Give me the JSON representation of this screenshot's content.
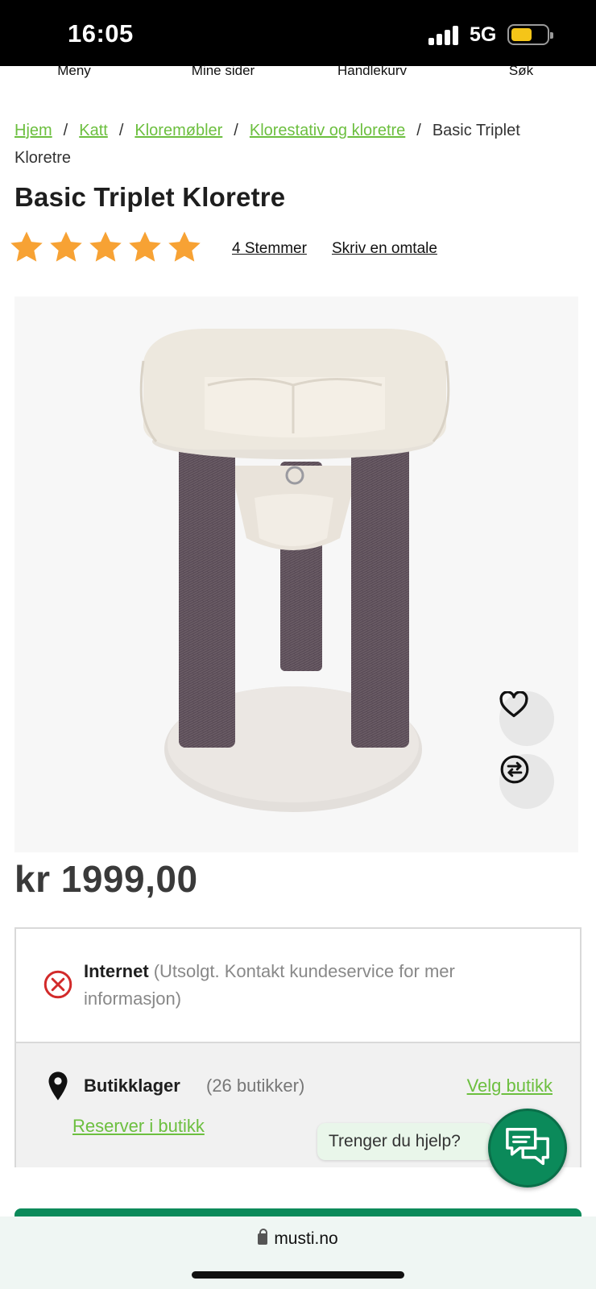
{
  "status_bar": {
    "time": "16:05",
    "network": "5G"
  },
  "top_nav": [
    "Meny",
    "Mine sider",
    "Handlekurv",
    "Søk"
  ],
  "breadcrumb": {
    "links": [
      "Hjem",
      "Katt",
      "Kloremøbler",
      "Klorestativ og kloretre"
    ],
    "current": "Basic Triplet Kloretre"
  },
  "product": {
    "title": "Basic Triplet Kloretre",
    "rating_stars": 5,
    "votes_label": "4 Stemmer",
    "review_label": "Skriv en omtale",
    "price": "kr 1999,00"
  },
  "availability": {
    "internet_label": "Internet",
    "internet_status": "(Utsolgt. Kontakt kundeservice for mer informasjon)",
    "store_label": "Butikklager",
    "store_count": "(26 butikker)",
    "select_store": "Velg butikk",
    "reserve": "Reserver i butikk"
  },
  "chat": {
    "prompt": "Trenger du hjelp?"
  },
  "browser": {
    "url": "musti.no"
  },
  "colors": {
    "accent_green": "#6cbf3f",
    "brand_green": "#0b8a5a",
    "star": "#f7a234",
    "error_red": "#d22a2a"
  }
}
